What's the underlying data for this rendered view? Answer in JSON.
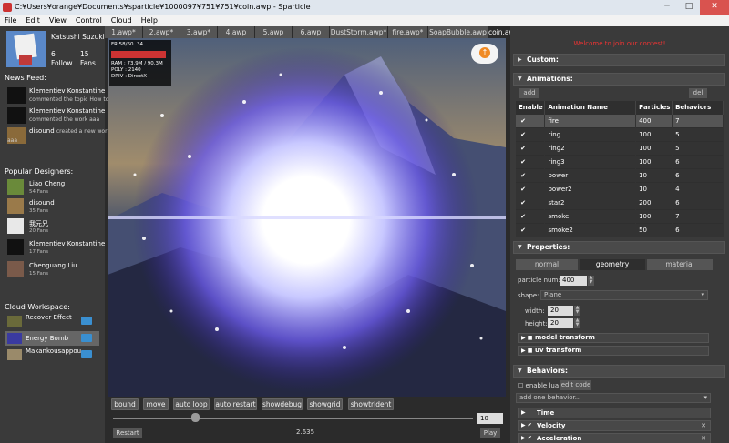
{
  "window": {
    "title": "C:¥Users¥orange¥Documents¥sparticle¥1000097¥751¥751¥coin.awp - Sparticle",
    "minimize": "─",
    "maximize": "□",
    "close": "✕"
  },
  "menu": [
    "File",
    "Edit",
    "View",
    "Control",
    "Cloud",
    "Help"
  ],
  "profile": {
    "name": "Katsushi Suzuki",
    "follow_count": "6",
    "follow_label": "Follow",
    "fans_count": "15",
    "fans_label": "Fans"
  },
  "news_feed": {
    "title": "News Feed:",
    "items": [
      {
        "user": "Klementiev Konstantine",
        "text": "commented the topic How to"
      },
      {
        "user": "Klementiev Konstantine",
        "text": "commented the work aaa"
      },
      {
        "user": "disound",
        "text": "created a new work",
        "text2": "aaa"
      }
    ]
  },
  "popular": {
    "title": "Popular Designers:",
    "items": [
      {
        "name": "Liao Cheng",
        "fans": "54 Fans"
      },
      {
        "name": "disound",
        "fans": "35 Fans"
      },
      {
        "name": "我元兄",
        "fans": "20 Fans"
      },
      {
        "name": "Klementiev Konstantine",
        "fans": "17 Fans"
      },
      {
        "name": "Chenguang Liu",
        "fans": "15 Fans"
      }
    ]
  },
  "workspace": {
    "title": "Cloud Workspace:",
    "items": [
      {
        "name": "Recover Effect"
      },
      {
        "name": "Energy Bomb"
      },
      {
        "name": "Makankousappou"
      }
    ]
  },
  "tabs": [
    "1.awp*",
    "2.awp*",
    "3.awp*",
    "4.awp",
    "5.awp",
    "6.awp",
    "DustStorm.awp*",
    "fire.awp*",
    "SoapBubble.awp",
    "coin.awp"
  ],
  "stats": {
    "fps": "FR:58/60",
    "count": "34",
    "ram": "RAM : 73.9M / 90.3M",
    "poly": "POLY : 2140",
    "drv": "DRIV : DirectX"
  },
  "viewport_buttons": [
    "bound",
    "move",
    "auto loop",
    "auto restart",
    "showdebug",
    "showgrid",
    "showtrident"
  ],
  "playback": {
    "position": 0.23,
    "end_value": "10",
    "restart": "Restart",
    "time": "2.635",
    "play": "Play"
  },
  "right": {
    "welcome": "Welcome to join our contest!",
    "custom": "Custom:",
    "animations": "Animations:",
    "add": "add",
    "del": "del",
    "columns": [
      "Enable",
      "Animation Name",
      "Particles",
      "Behaviors"
    ],
    "rows": [
      {
        "enabled": "✔",
        "name": "fire",
        "particles": "400",
        "behaviors": "7"
      },
      {
        "enabled": "✔",
        "name": "ring",
        "particles": "100",
        "behaviors": "5"
      },
      {
        "enabled": "✔",
        "name": "ring2",
        "particles": "100",
        "behaviors": "5"
      },
      {
        "enabled": "✔",
        "name": "ring3",
        "particles": "100",
        "behaviors": "6"
      },
      {
        "enabled": "✔",
        "name": "power",
        "particles": "10",
        "behaviors": "6"
      },
      {
        "enabled": "✔",
        "name": "power2",
        "particles": "10",
        "behaviors": "4"
      },
      {
        "enabled": "✔",
        "name": "star2",
        "particles": "200",
        "behaviors": "6"
      },
      {
        "enabled": "✔",
        "name": "smoke",
        "particles": "100",
        "behaviors": "7"
      },
      {
        "enabled": "✔",
        "name": "smoke2",
        "particles": "50",
        "behaviors": "6"
      }
    ],
    "properties": "Properties:",
    "prop_tabs": [
      "normal",
      "geometry",
      "material"
    ],
    "particle_num_label": "particle num:",
    "particle_num": "400",
    "shape_label": "shape:",
    "shape": "Plane",
    "width_label": "width:",
    "width": "20",
    "height_label": "height:",
    "height": "20",
    "model_transform": "model transform",
    "uv_transform": "uv transform",
    "behaviors": "Behaviors:",
    "enable_lua": "enable lua",
    "edit_code": "edit code",
    "add_behavior": "add one behavior...",
    "behavior_items": [
      "Time",
      "Velocity",
      "Acceleration"
    ]
  }
}
